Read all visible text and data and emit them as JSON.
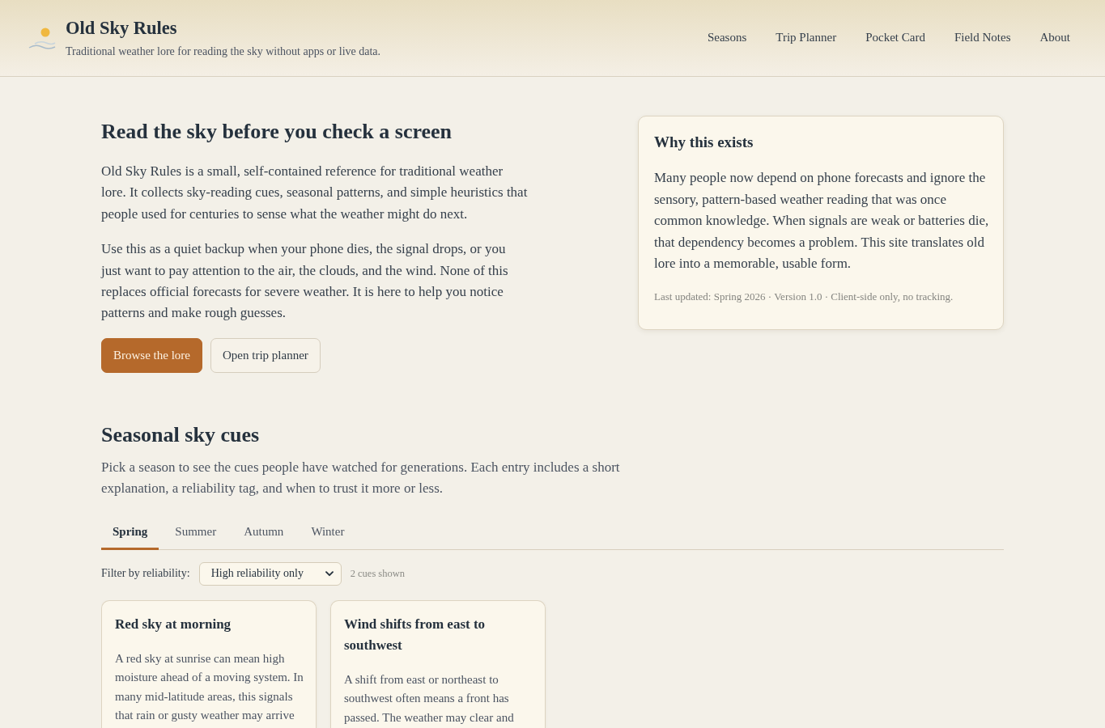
{
  "header": {
    "title": "Old Sky Rules",
    "tagline": "Traditional weather lore for reading the sky without apps or live data.",
    "nav": [
      "Seasons",
      "Trip Planner",
      "Pocket Card",
      "Field Notes",
      "About"
    ]
  },
  "hero": {
    "heading": "Read the sky before you check a screen",
    "paragraphs": [
      "Old Sky Rules is a small, self-contained reference for traditional weather lore. It collects sky-reading cues, seasonal patterns, and simple heuristics that people used for centuries to sense what the weather might do next.",
      "Use this as a quiet backup when your phone dies, the signal drops, or you just want to pay attention to the air, the clouds, and the wind. None of this replaces official forecasts for severe weather. It is here to help you notice patterns and make rough guesses."
    ],
    "buttons": [
      {
        "label": "Browse the lore",
        "kind": "primary"
      },
      {
        "label": "Open trip planner",
        "kind": "secondary"
      }
    ]
  },
  "about_card": {
    "title": "Why this exists",
    "body": "Many people now depend on phone forecasts and ignore the sensory, pattern-based weather reading that was once common knowledge. When signals are weak or batteries die, that dependency becomes a problem. This site translates old lore into a memorable, usable form.",
    "meta": "Last updated: Spring 2026 · Version 1.0 · Client-side only, no tracking."
  },
  "seasonal": {
    "heading": "Seasonal sky cues",
    "intro": "Pick a season to see the cues people have watched for generations. Each entry includes a short explanation, a reliability tag, and when to trust it more or less.",
    "tabs": [
      {
        "label": "Spring",
        "selected": true
      },
      {
        "label": "Summer",
        "selected": false
      },
      {
        "label": "Autumn",
        "selected": false
      },
      {
        "label": "Winter",
        "selected": false
      }
    ],
    "filter": {
      "label": "Filter by reliability:",
      "value": "High reliability only"
    },
    "count": "2 cues shown",
    "cues": [
      {
        "title": "Red sky at morning",
        "body": "A red sky at sunrise can mean high moisture ahead of a moving system. In many mid-latitude areas, this signals that rain or gusty weather may arrive"
      },
      {
        "title": "Wind shifts from east to southwest",
        "body": "A shift from east or northeast to southwest often means a front has passed. The weather may clear and"
      }
    ]
  }
}
